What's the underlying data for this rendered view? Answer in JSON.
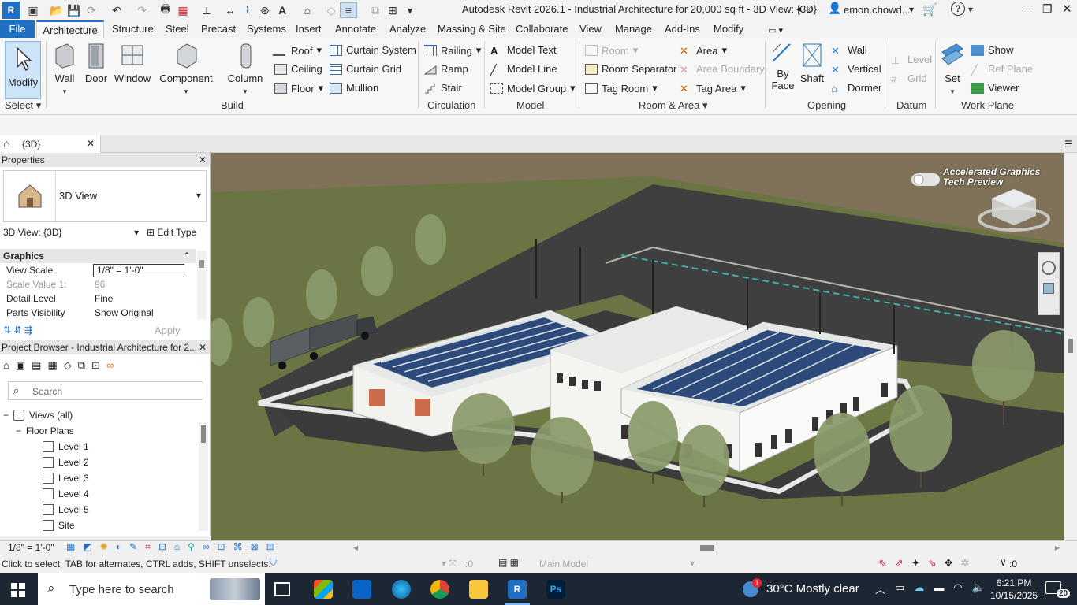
{
  "title_bar": {
    "app_title": "Autodesk Revit 2026.1 - Industrial Architecture for 20,000 sq ft - 3D View: {3D}",
    "user": "emon.chowd...",
    "logo_letter": "R"
  },
  "menu_tabs": [
    "File",
    "Architecture",
    "Structure",
    "Steel",
    "Precast",
    "Systems",
    "Insert",
    "Annotate",
    "Analyze",
    "Massing & Site",
    "Collaborate",
    "View",
    "Manage",
    "Add-Ins",
    "Modify"
  ],
  "ribbon": {
    "select": {
      "modify": "Modify",
      "label": "Select"
    },
    "build": {
      "wall": "Wall",
      "door": "Door",
      "window": "Window",
      "component": "Component",
      "column": "Column",
      "roof": "Roof",
      "ceiling": "Ceiling",
      "floor": "Floor",
      "curtain_system": "Curtain System",
      "curtain_grid": "Curtain Grid",
      "mullion": "Mullion",
      "label": "Build"
    },
    "circulation": {
      "railing": "Railing",
      "ramp": "Ramp",
      "stair": "Stair",
      "label": "Circulation"
    },
    "model": {
      "model_text": "Model Text",
      "model_line": "Model Line",
      "model_group": "Model Group",
      "label": "Model"
    },
    "room_area": {
      "room": "Room",
      "room_separator": "Room Separator",
      "tag_room": "Tag Room",
      "area": "Area",
      "area_boundary": "Area Boundary",
      "tag_area": "Tag Area",
      "label": "Room & Area"
    },
    "opening": {
      "by_face": "By Face",
      "by_face_1": "By",
      "by_face_2": "Face",
      "shaft": "Shaft",
      "wall": "Wall",
      "vertical": "Vertical",
      "dormer": "Dormer",
      "label": "Opening"
    },
    "datum": {
      "level": "Level",
      "grid": "Grid",
      "label": "Datum"
    },
    "work_plane": {
      "set": "Set",
      "show": "Show",
      "ref_plane": "Ref Plane",
      "viewer": "Viewer",
      "label": "Work Plane"
    }
  },
  "view_tab": {
    "label": "{3D}"
  },
  "properties": {
    "title": "Properties",
    "type_name": "3D View",
    "instance_selector": "3D View: {3D}",
    "edit_type": "Edit Type",
    "section": "Graphics",
    "rows": [
      {
        "key": "View Scale",
        "value": "1/8\" = 1'-0\""
      },
      {
        "key": "Scale Value    1:",
        "value": "96"
      },
      {
        "key": "Detail Level",
        "value": "Fine"
      },
      {
        "key": "Parts Visibility",
        "value": "Show Original"
      }
    ],
    "apply": "Apply"
  },
  "project_browser": {
    "title": "Project Browser - Industrial Architecture for 2...",
    "search_placeholder": "Search",
    "views_all": "Views (all)",
    "floor_plans": "Floor Plans",
    "items": [
      "Level 1",
      "Level 2",
      "Level 3",
      "Level 4",
      "Level 5",
      "Site"
    ]
  },
  "viewport": {
    "overlay_title_1": "Accelerated Graphics",
    "overlay_title_2": "Tech Preview"
  },
  "view_control": {
    "scale": "1/8\" = 1'-0\""
  },
  "status_bar": {
    "hint": "Click to select, TAB for alternates, CTRL adds, SHIFT unselects.",
    "count": ":0",
    "model": "Main Model",
    "filter_count": ":0"
  },
  "taskbar": {
    "search_placeholder": "Type here to search",
    "weather": "30°C  Mostly clear",
    "time": "6:21 PM",
    "date": "10/15/2025",
    "notif_count": "20",
    "weather_badge": "1"
  },
  "colors": {
    "accent": "#1f6fc2",
    "grass": "#6b7544",
    "asphalt": "#3e3f3e",
    "taskbar": "#1d2733"
  }
}
